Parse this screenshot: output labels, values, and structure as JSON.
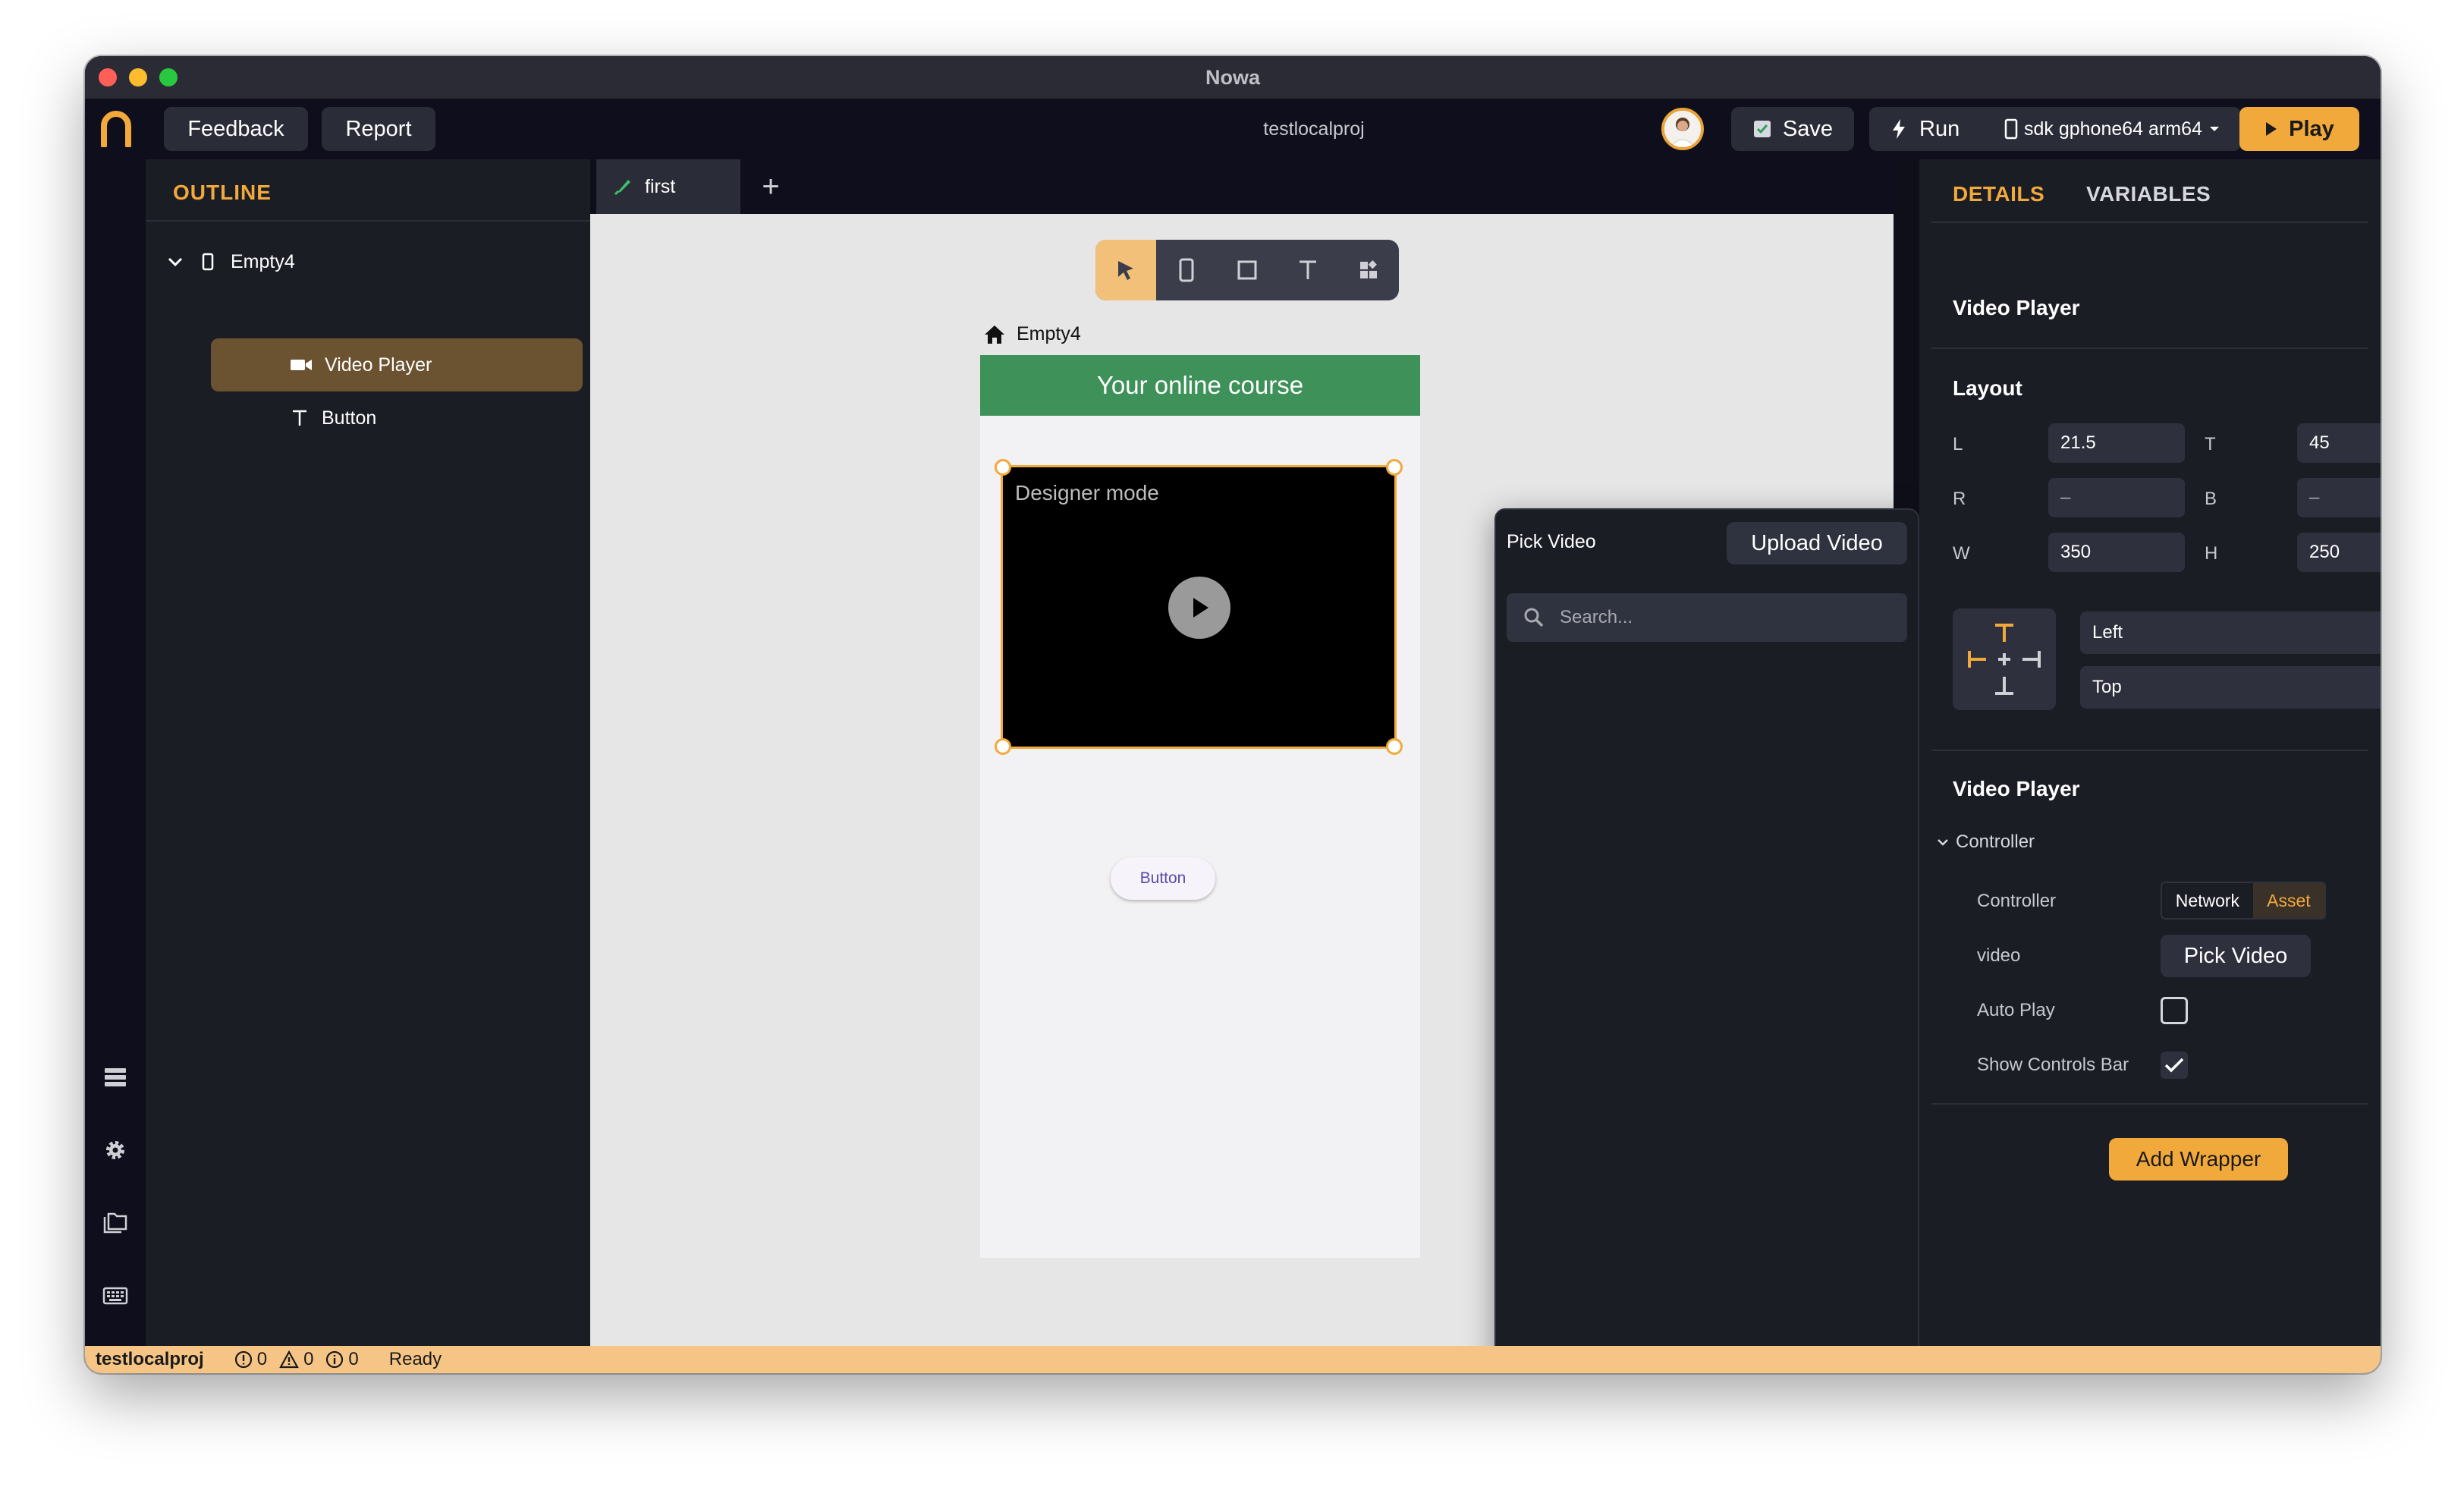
{
  "window": {
    "title": "Nowa"
  },
  "toolbar": {
    "feedback_label": "Feedback",
    "report_label": "Report",
    "project_name": "testlocalproj",
    "save_label": "Save",
    "run_label": "Run",
    "device_label": "sdk gphone64 arm64",
    "play_label": "Play"
  },
  "outline": {
    "title": "OUTLINE",
    "items": [
      {
        "label": "Empty4",
        "icon": "phone-icon"
      },
      {
        "label": "Video Player",
        "icon": "video-camera-icon"
      },
      {
        "label": "Button",
        "icon": "text-t-icon"
      }
    ]
  },
  "tabs": {
    "first_label": "first",
    "add_label": "+"
  },
  "canvas": {
    "breadcrumb": "Empty4",
    "appbar_title": "Your online course",
    "video_label": "Designer mode",
    "button_label": "Button"
  },
  "popup": {
    "title": "Pick Video",
    "upload_label": "Upload Video",
    "search_placeholder": "Search..."
  },
  "details": {
    "tab_details": "DETAILS",
    "tab_variables": "VARIABLES",
    "widget_title": "Video Player",
    "layout_title": "Layout",
    "fields": {
      "L": {
        "label": "L",
        "value": "21.5"
      },
      "T": {
        "label": "T",
        "value": "45"
      },
      "R": {
        "label": "R",
        "value": "–"
      },
      "B": {
        "label": "B",
        "value": "–"
      },
      "W": {
        "label": "W",
        "value": "350"
      },
      "H": {
        "label": "H",
        "value": "250"
      }
    },
    "horizontal_align": "Left",
    "vertical_align": "Top",
    "section_title": "Video Player",
    "controller_group": "Controller",
    "controller_label": "Controller",
    "controller_options": [
      "Network",
      "Asset"
    ],
    "controller_selected": "Asset",
    "video_label": "video",
    "pick_video_label": "Pick Video",
    "auto_play_label": "Auto Play",
    "auto_play": false,
    "show_controls_label": "Show Controls Bar",
    "show_controls": true,
    "add_wrapper_label": "Add Wrapper"
  },
  "status": {
    "project": "testlocalproj",
    "errors": "0",
    "warnings": "0",
    "infos": "0",
    "state": "Ready"
  },
  "colors": {
    "accent": "#f2a93b",
    "appbar_green": "#3e9159",
    "panel_bg": "#1b1d25",
    "toolbar_bg": "#0e0e1c",
    "status_bg": "#f6c586"
  }
}
